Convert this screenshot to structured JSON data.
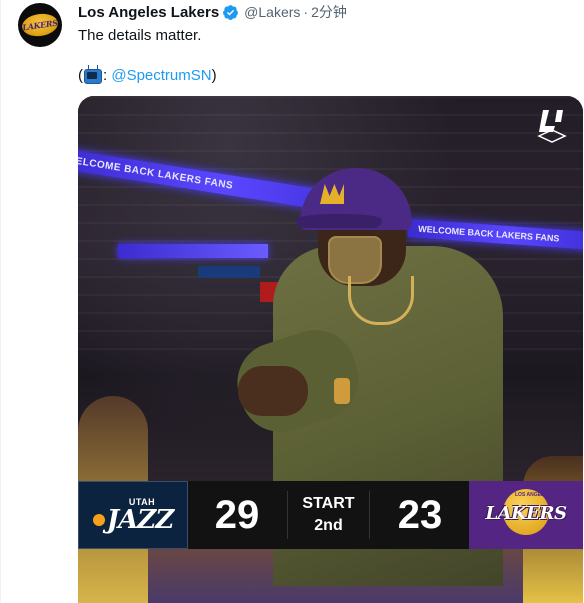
{
  "tweet": {
    "display_name": "Los Angeles Lakers",
    "handle": "@Lakers",
    "separator": "·",
    "time": "2分钟",
    "text": "The details matter.",
    "line2_open": "(",
    "line2_colon": ": ",
    "mention": "@SpectrumSN",
    "line2_close": ")"
  },
  "avatar": {
    "icon": "lakers-logo-icon",
    "label": "LAKERS"
  },
  "media": {
    "banner_text": "WELCOME BACK LAKERS FANS",
    "watermark_icon": "la-watermark-icon",
    "scorebug": {
      "away_team": {
        "city": "UTAH",
        "name": "JAZZ",
        "score": "29"
      },
      "home_team": {
        "arc": "LOS ANGELES",
        "name": "LAKERS",
        "score": "23"
      },
      "status": "START",
      "period": "2nd"
    }
  },
  "colors": {
    "accent_link": "#1d9bf0",
    "verified": "#1d9bf0",
    "lakers_purple": "#552583",
    "jazz_navy": "#0c2340"
  }
}
